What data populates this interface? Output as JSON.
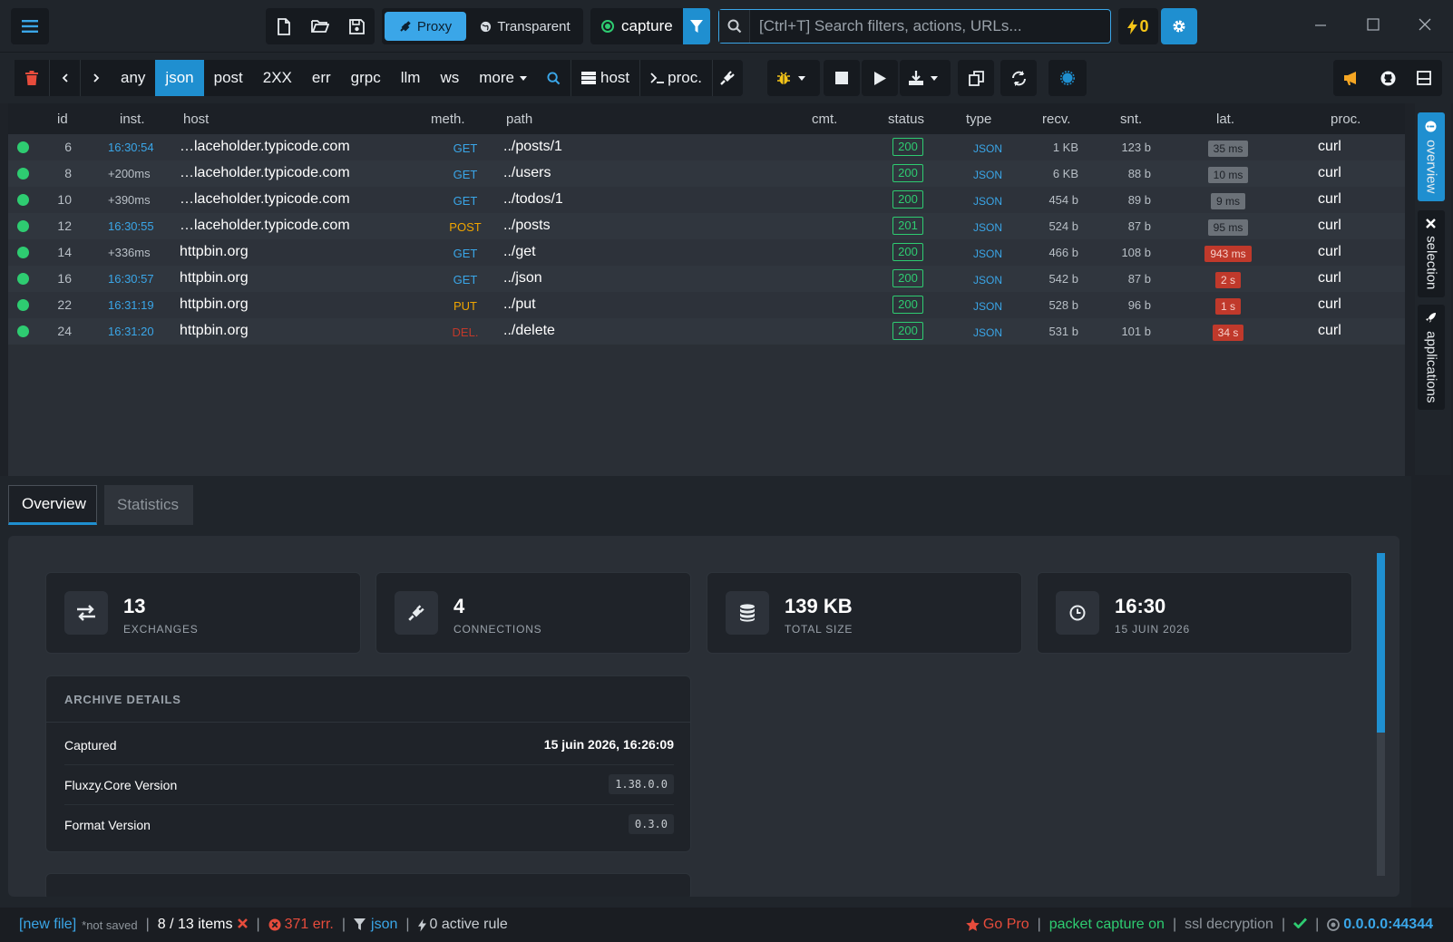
{
  "titlebar": {
    "mode_proxy": "Proxy",
    "mode_transparent": "Transparent",
    "capture_label": "capture",
    "search_placeholder": "[Ctrl+T] Search filters, actions, URLs...",
    "rule_count": "0"
  },
  "toolbar": {
    "filters": [
      "any",
      "json",
      "post",
      "2XX",
      "err",
      "grpc",
      "llm",
      "ws",
      "more"
    ],
    "active_filter": "json",
    "host_label": "host",
    "proc_label": "proc."
  },
  "table": {
    "headers": {
      "id": "id",
      "inst": "inst.",
      "host": "host",
      "meth": "meth.",
      "path": "path",
      "cmt": "cmt.",
      "status": "status",
      "type": "type",
      "recv": "recv.",
      "snt": "snt.",
      "lat": "lat.",
      "proc": "proc."
    },
    "rows": [
      {
        "id": "6",
        "inst": "16:30:54",
        "inst_kind": "time",
        "host": "…laceholder.typicode.com",
        "meth": "GET",
        "path": "../posts/1",
        "status": "200",
        "type": "JSON",
        "recv": "1 KB",
        "snt": "123 b",
        "lat": "35 ms",
        "lat_kind": "ok",
        "proc": "curl"
      },
      {
        "id": "8",
        "inst": "+200ms",
        "inst_kind": "rel",
        "host": "…laceholder.typicode.com",
        "meth": "GET",
        "path": "../users",
        "status": "200",
        "type": "JSON",
        "recv": "6 KB",
        "snt": "88 b",
        "lat": "10 ms",
        "lat_kind": "ok",
        "proc": "curl"
      },
      {
        "id": "10",
        "inst": "+390ms",
        "inst_kind": "rel",
        "host": "…laceholder.typicode.com",
        "meth": "GET",
        "path": "../todos/1",
        "status": "200",
        "type": "JSON",
        "recv": "454 b",
        "snt": "89 b",
        "lat": "9 ms",
        "lat_kind": "ok",
        "proc": "curl"
      },
      {
        "id": "12",
        "inst": "16:30:55",
        "inst_kind": "time",
        "host": "…laceholder.typicode.com",
        "meth": "POST",
        "path": "../posts",
        "status": "201",
        "type": "JSON",
        "recv": "524 b",
        "snt": "87 b",
        "lat": "95 ms",
        "lat_kind": "ok",
        "proc": "curl"
      },
      {
        "id": "14",
        "inst": "+336ms",
        "inst_kind": "rel",
        "host": "httpbin.org",
        "meth": "GET",
        "path": "../get",
        "status": "200",
        "type": "JSON",
        "recv": "466 b",
        "snt": "108 b",
        "lat": "943 ms",
        "lat_kind": "bad",
        "proc": "curl"
      },
      {
        "id": "16",
        "inst": "16:30:57",
        "inst_kind": "time",
        "host": "httpbin.org",
        "meth": "GET",
        "path": "../json",
        "status": "200",
        "type": "JSON",
        "recv": "542 b",
        "snt": "87 b",
        "lat": "2 s",
        "lat_kind": "bad",
        "proc": "curl"
      },
      {
        "id": "22",
        "inst": "16:31:19",
        "inst_kind": "time",
        "host": "httpbin.org",
        "meth": "PUT",
        "path": "../put",
        "status": "200",
        "type": "JSON",
        "recv": "528 b",
        "snt": "96 b",
        "lat": "1 s",
        "lat_kind": "bad",
        "proc": "curl"
      },
      {
        "id": "24",
        "inst": "16:31:20",
        "inst_kind": "time",
        "host": "httpbin.org",
        "meth": "DEL.",
        "path": "../delete",
        "status": "200",
        "type": "JSON",
        "recv": "531 b",
        "snt": "101 b",
        "lat": "34 s",
        "lat_kind": "bad",
        "proc": "curl"
      }
    ]
  },
  "sidetabs": {
    "overview": "overview",
    "selection": "selection",
    "applications": "applications"
  },
  "bottom": {
    "tab_overview": "Overview",
    "tab_statistics": "Statistics",
    "cards": [
      {
        "value": "13",
        "label": "EXCHANGES"
      },
      {
        "value": "4",
        "label": "CONNECTIONS"
      },
      {
        "value": "139 KB",
        "label": "TOTAL SIZE"
      },
      {
        "value": "16:30",
        "label": "15 JUIN 2026"
      }
    ],
    "archive": {
      "title": "ARCHIVE DETAILS",
      "captured_label": "Captured",
      "captured_value": "15 juin 2026, 16:26:09",
      "core_label": "Fluxzy.Core Version",
      "core_value": "1.38.0.0",
      "format_label": "Format Version",
      "format_value": "0.3.0"
    }
  },
  "statusbar": {
    "file": "[new file]",
    "not_saved": "*not saved",
    "items": "8 / 13 items",
    "errors": "371 err.",
    "filter": "json",
    "rules": "0 active rule",
    "go_pro": "Go Pro",
    "packet_capture": "packet capture on",
    "ssl": "ssl decryption",
    "address": "0.0.0.0:44344"
  },
  "colors": {
    "accent": "#1f8fd0",
    "accent_light": "#3aa6e8",
    "ok_green": "#2ecc71",
    "error_red": "#e74c3c",
    "warning": "#f0a500"
  }
}
